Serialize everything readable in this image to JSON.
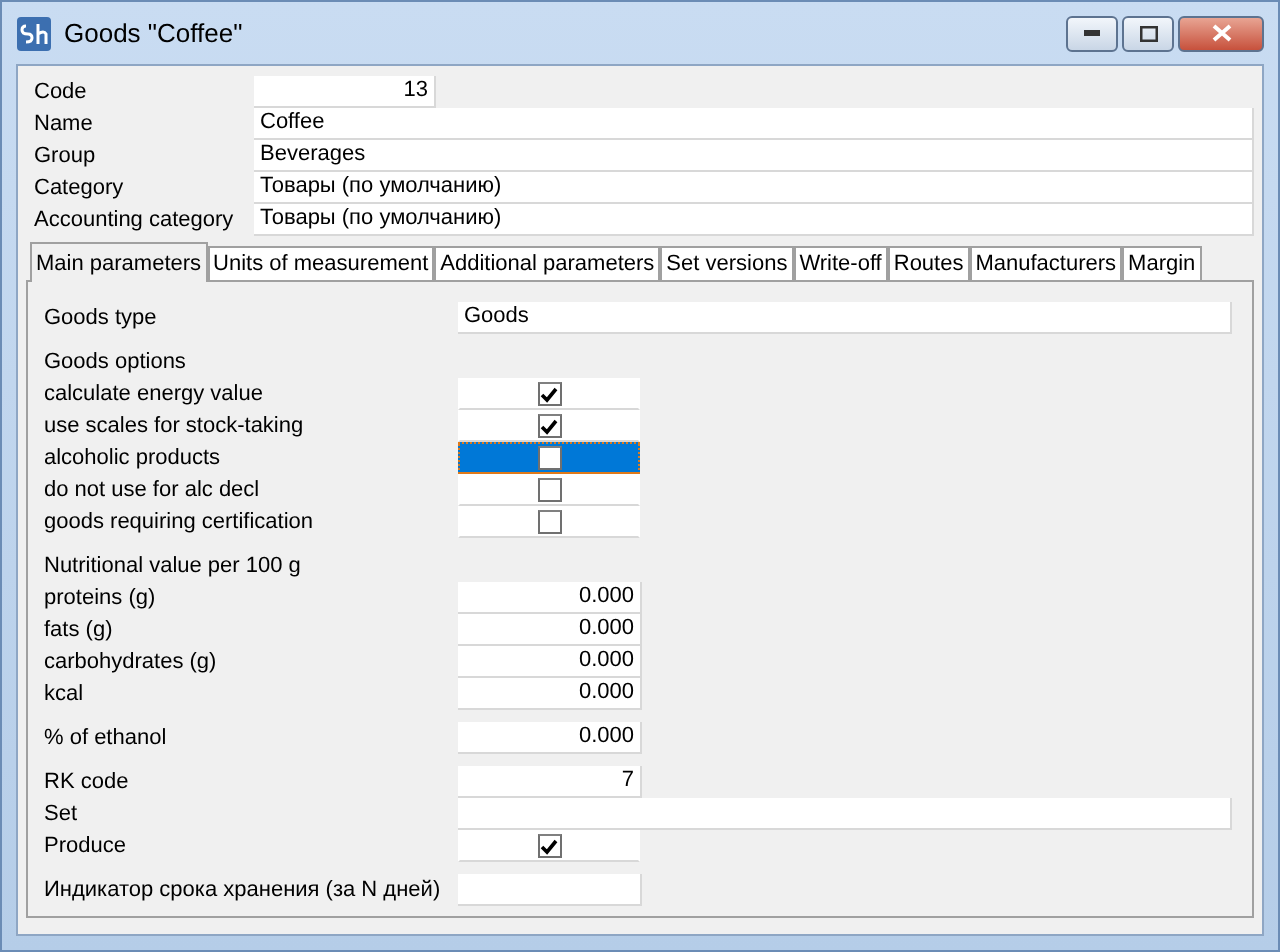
{
  "window": {
    "title": "Goods \"Coffee\""
  },
  "header": [
    {
      "label": "Code",
      "value": "13",
      "kind": "number"
    },
    {
      "label": "Name",
      "value": "Coffee",
      "kind": "text"
    },
    {
      "label": "Group",
      "value": "Beverages",
      "kind": "text"
    },
    {
      "label": "Category",
      "value": "Товары (по умолчанию)",
      "kind": "text"
    },
    {
      "label": "Accounting category",
      "value": "Товары (по умолчанию)",
      "kind": "text"
    }
  ],
  "tabs": [
    {
      "label": "Main parameters",
      "selected": true
    },
    {
      "label": "Units of measurement",
      "selected": false
    },
    {
      "label": "Additional parameters",
      "selected": false
    },
    {
      "label": "Set versions",
      "selected": false
    },
    {
      "label": "Write-off",
      "selected": false
    },
    {
      "label": "Routes",
      "selected": false
    },
    {
      "label": "Manufacturers",
      "selected": false
    },
    {
      "label": "Margin",
      "selected": false
    }
  ],
  "sections": [
    {
      "rows": [
        {
          "kind": "text",
          "label": "Goods type",
          "value": "Goods"
        }
      ]
    },
    {
      "rows": [
        {
          "kind": "heading",
          "label": "Goods options"
        },
        {
          "kind": "check",
          "label": "calculate energy value",
          "checked": true,
          "selected": false
        },
        {
          "kind": "check",
          "label": "use scales for stock-taking",
          "checked": true,
          "selected": false
        },
        {
          "kind": "check",
          "label": "alcoholic products",
          "checked": false,
          "selected": true
        },
        {
          "kind": "check",
          "label": "do not use for alc decl",
          "checked": false,
          "selected": false
        },
        {
          "kind": "check",
          "label": "goods requiring certification",
          "checked": false,
          "selected": false
        }
      ]
    },
    {
      "rows": [
        {
          "kind": "heading",
          "label": "Nutritional value per 100 g"
        },
        {
          "kind": "number",
          "label": "proteins (g)",
          "value": "0.000"
        },
        {
          "kind": "number",
          "label": "fats (g)",
          "value": "0.000"
        },
        {
          "kind": "number",
          "label": "carbohydrates (g)",
          "value": "0.000"
        },
        {
          "kind": "number",
          "label": "kcal",
          "value": "0.000"
        }
      ]
    },
    {
      "rows": [
        {
          "kind": "number",
          "label": "% of ethanol",
          "value": "0.000"
        }
      ]
    },
    {
      "rows": [
        {
          "kind": "number",
          "label": "RK code",
          "value": "7"
        },
        {
          "kind": "text",
          "label": "Set"
        },
        {
          "kind": "check",
          "label": "Produce",
          "checked": true,
          "selected": false
        }
      ]
    },
    {
      "rows": [
        {
          "kind": "number",
          "label": "Индикатор срока хранения (за N дней)"
        }
      ]
    }
  ]
}
